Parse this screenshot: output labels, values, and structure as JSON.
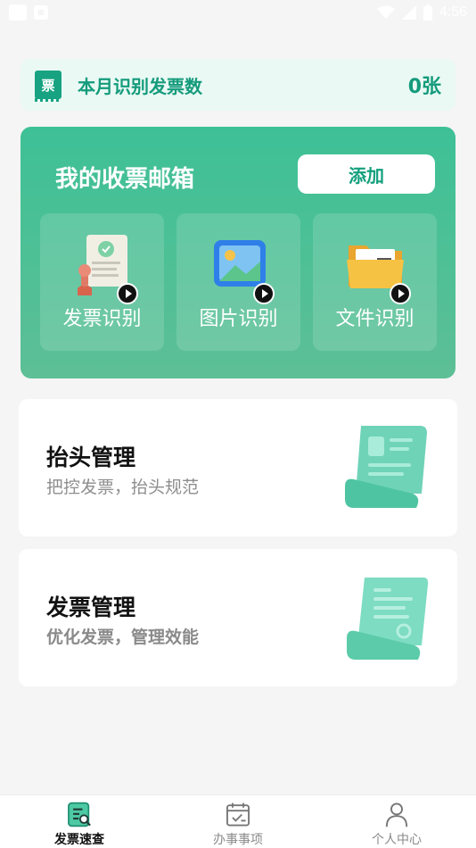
{
  "status_bar": {
    "time": "4:56"
  },
  "invoice_count": {
    "label": "本月识别发票数",
    "value": "0张",
    "ticket_glyph": "票"
  },
  "mailbox": {
    "title": "我的收票邮箱",
    "add_label": "添加",
    "tiles": [
      {
        "label": "发票识别",
        "icon": "invoice-stamp-icon"
      },
      {
        "label": "图片识别",
        "icon": "picture-icon"
      },
      {
        "label": "文件识别",
        "icon": "folder-icon"
      }
    ]
  },
  "cards": {
    "header_mgmt": {
      "title": "抬头管理",
      "subtitle": "把控发票，抬头规范"
    },
    "invoice_mgmt": {
      "title": "发票管理",
      "subtitle": "优化发票，管理效能"
    }
  },
  "bottom_nav": {
    "items": [
      {
        "label": "发票速查",
        "icon": "invoice-search-icon",
        "active": true
      },
      {
        "label": "办事事项",
        "icon": "calendar-check-icon",
        "active": false
      },
      {
        "label": "个人中心",
        "icon": "person-icon",
        "active": false
      }
    ]
  },
  "colors": {
    "accent": "#149b7b",
    "card_green": "#4fbf94",
    "background": "#f4f5f4"
  }
}
